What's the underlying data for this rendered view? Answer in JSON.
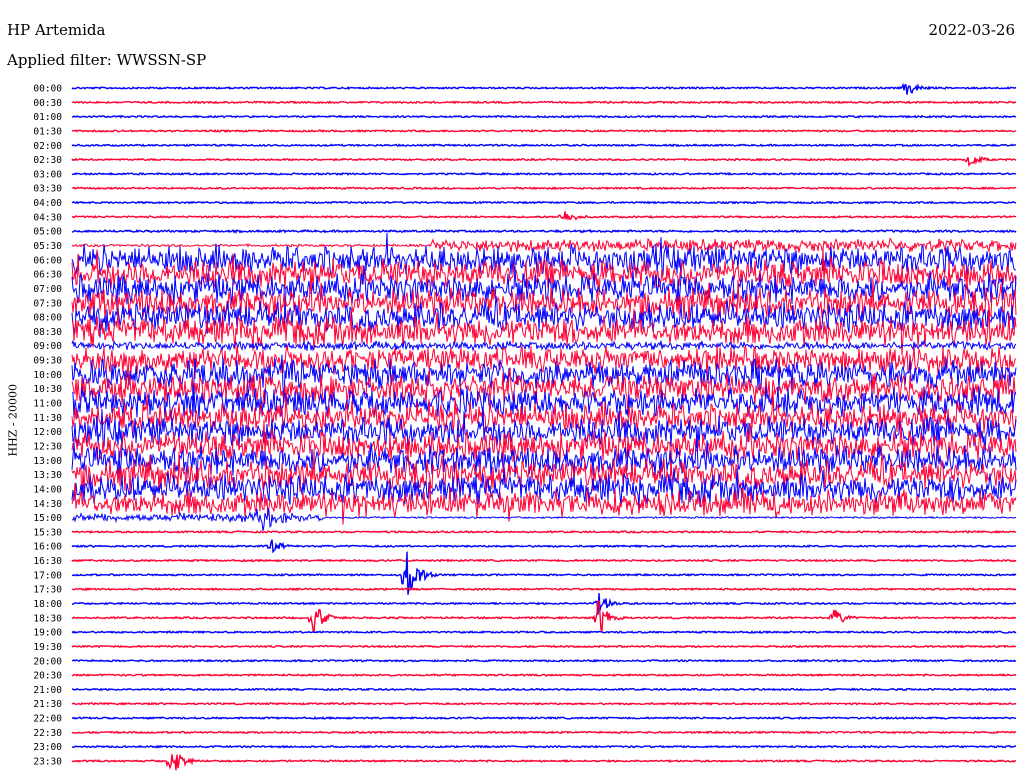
{
  "header": {
    "station": "HP Artemida",
    "filter": "Applied filter: WWSSN-SP",
    "date": "2022-03-26"
  },
  "chart_data": {
    "type": "line",
    "title": "HP Artemida",
    "ylabel": "HHZ - 20000",
    "colors": [
      "#0000ff",
      "#ff0033"
    ],
    "row_labels": [
      "00:00",
      "00:30",
      "01:00",
      "01:30",
      "02:00",
      "02:30",
      "03:00",
      "03:30",
      "04:00",
      "04:30",
      "05:00",
      "05:30",
      "06:00",
      "06:30",
      "07:00",
      "07:30",
      "08:00",
      "08:30",
      "09:00",
      "09:30",
      "10:00",
      "10:30",
      "11:00",
      "11:30",
      "12:00",
      "12:30",
      "13:00",
      "13:30",
      "14:00",
      "14:30",
      "15:00",
      "15:30",
      "16:00",
      "16:30",
      "17:00",
      "17:30",
      "18:00",
      "18:30",
      "19:00",
      "19:30",
      "20:00",
      "20:30",
      "21:00",
      "21:30",
      "22:00",
      "22:30",
      "23:00",
      "23:30"
    ],
    "activity_level": [
      0.1,
      0.1,
      0.1,
      0.1,
      0.1,
      0.1,
      0.12,
      0.1,
      0.12,
      0.15,
      0.25,
      0.6,
      0.9,
      0.9,
      0.9,
      0.9,
      0.9,
      0.9,
      0.5,
      0.85,
      0.9,
      0.9,
      0.9,
      0.9,
      0.9,
      0.9,
      0.9,
      0.9,
      0.9,
      0.85,
      0.5,
      0.12,
      0.12,
      0.1,
      0.12,
      0.1,
      0.12,
      0.1,
      0.1,
      0.1,
      0.1,
      0.1,
      0.1,
      0.1,
      0.1,
      0.1,
      0.1,
      0.1
    ],
    "events": [
      {
        "row": "00:00",
        "minute": 26.5,
        "amplitude": 1.0
      },
      {
        "row": "02:30",
        "minute": 28.5,
        "amplitude": 0.8
      },
      {
        "row": "04:30",
        "minute": 15.6,
        "amplitude": 0.8
      },
      {
        "row": "15:00",
        "minute": 6.0,
        "amplitude": 1.5
      },
      {
        "row": "16:00",
        "minute": 6.3,
        "amplitude": 0.8
      },
      {
        "row": "17:00",
        "minute": 10.6,
        "amplitude": 3.0
      },
      {
        "row": "18:00",
        "minute": 16.7,
        "amplitude": 1.2
      },
      {
        "row": "18:30",
        "minute": 7.6,
        "amplitude": 2.0
      },
      {
        "row": "18:30",
        "minute": 16.7,
        "amplitude": 2.0
      },
      {
        "row": "18:30",
        "minute": 24.2,
        "amplitude": 1.0
      },
      {
        "row": "23:30",
        "minute": 3.1,
        "amplitude": 1.8
      }
    ]
  }
}
